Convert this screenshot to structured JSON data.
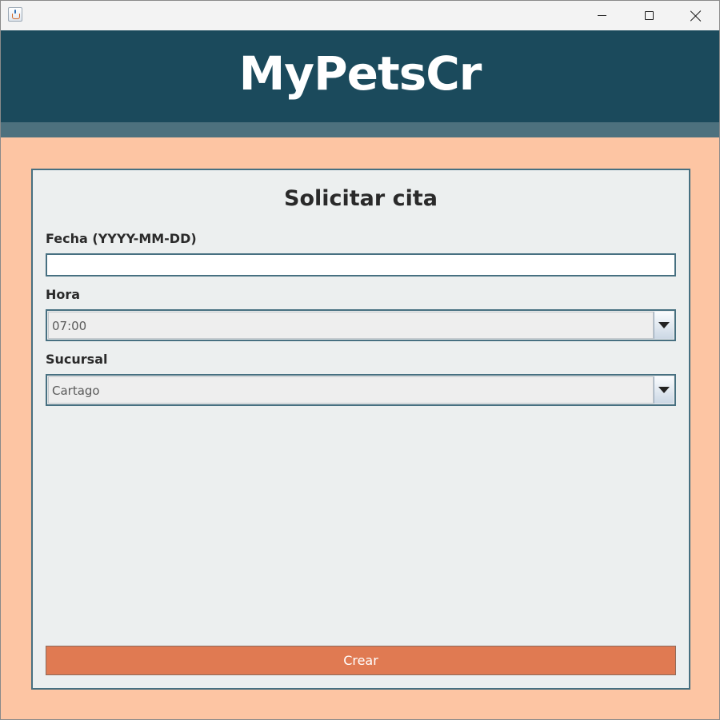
{
  "app": {
    "brand": "MyPetsCr"
  },
  "form": {
    "title": "Solicitar cita",
    "fecha": {
      "label": "Fecha (YYYY-MM-DD)",
      "value": "",
      "placeholder": ""
    },
    "hora": {
      "label": "Hora",
      "selected": "07:00"
    },
    "sucursal": {
      "label": "Sucursal",
      "selected": "Cartago"
    },
    "submit_label": "Crear"
  },
  "colors": {
    "header": "#1b4a5c",
    "header_strip": "#4d717e",
    "background": "#fdc5a3",
    "card": "#ecefef",
    "card_border": "#477081",
    "button": "#e07a52"
  },
  "icons": {
    "app": "java-app-icon",
    "minimize": "minimize-icon",
    "maximize": "maximize-icon",
    "close": "close-icon",
    "dropdown": "chevron-down-icon"
  }
}
